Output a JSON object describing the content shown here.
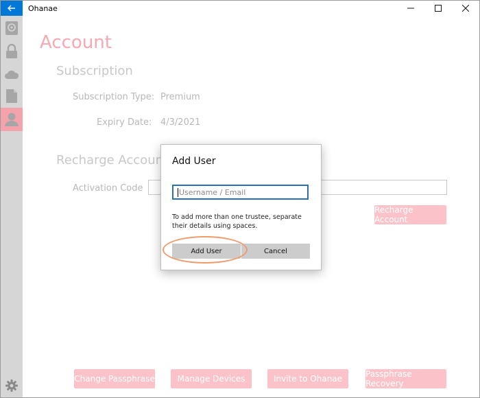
{
  "app": {
    "title": "Ohanae"
  },
  "window_controls": {
    "minimize": "—",
    "maximize": "☐",
    "close": "✕"
  },
  "colors": {
    "accent": "#0078d7",
    "brand_pink": "#f7a8b1",
    "button_pink": "#fbc3c9",
    "sidebar": "#d6d6d6"
  },
  "sidebar": {
    "items": [
      {
        "icon": "safe-icon"
      },
      {
        "icon": "lock-icon"
      },
      {
        "icon": "cloud-icon"
      },
      {
        "icon": "document-icon"
      },
      {
        "icon": "user-icon",
        "active": true
      }
    ],
    "footer_icon": "gear-icon"
  },
  "page": {
    "title": "Account",
    "subscription": {
      "heading": "Subscription",
      "type_label": "Subscription Type:",
      "type_value": "Premium",
      "expiry_label": "Expiry Date:",
      "expiry_value": "4/3/2021"
    },
    "recharge": {
      "heading": "Recharge Account",
      "activation_label": "Activation Code",
      "recharge_button": "Recharge Account"
    },
    "bottom_buttons": {
      "change_passphrase": "Change Passphrase",
      "manage_devices": "Manage Devices",
      "invite": "Invite to Ohanae",
      "recovery": "Passphrase Recovery"
    }
  },
  "dialog": {
    "title": "Add User",
    "input_placeholder": "Username / Email",
    "help_text": "To add more than one trustee, separate their details using spaces.",
    "add_button": "Add User",
    "cancel_button": "Cancel"
  }
}
